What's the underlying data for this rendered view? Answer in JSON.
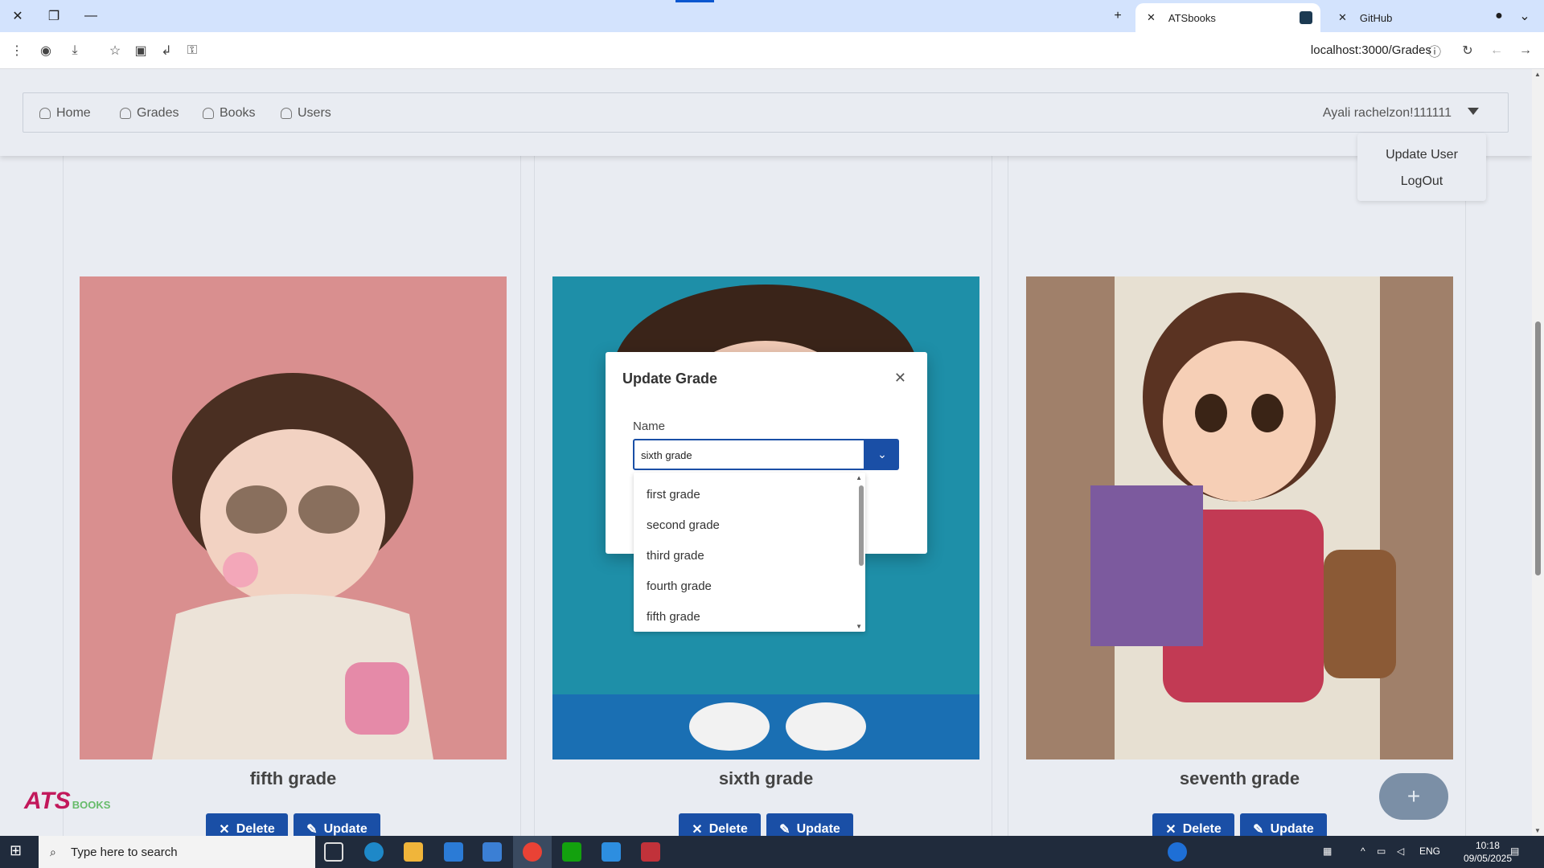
{
  "browser": {
    "tabs": [
      {
        "label": "ATSbooks",
        "active": true
      },
      {
        "label": "GitHub",
        "active": false
      }
    ],
    "url": "localhost:3000/Grades"
  },
  "nav": {
    "links": [
      "Home",
      "Grades",
      "Books",
      "Users"
    ],
    "user": "Ayali rachelzon!111111",
    "menu": [
      "Update User",
      "LogOut"
    ]
  },
  "cards": [
    {
      "title": "fifth grade",
      "delete": "Delete",
      "update": "Update"
    },
    {
      "title": "sixth grade",
      "delete": "Delete",
      "update": "Update"
    },
    {
      "title": "seventh grade",
      "delete": "Delete",
      "update": "Update"
    }
  ],
  "logo": {
    "main": "ATS",
    "sub": "BOOKS"
  },
  "fab": "+",
  "modal": {
    "title": "Update Grade",
    "field_label": "Name",
    "value": "sixth grade",
    "options": [
      "first grade",
      "second grade",
      "third grade",
      "fourth grade",
      "fifth grade"
    ]
  },
  "taskbar": {
    "search_placeholder": "Type here to search",
    "lang": "ENG",
    "time": "10:18",
    "date": "09/05/2025"
  },
  "colors": {
    "accent": "#1a4fa6",
    "tab_bar": "#d3e3fd",
    "taskbar": "#202b3c"
  }
}
